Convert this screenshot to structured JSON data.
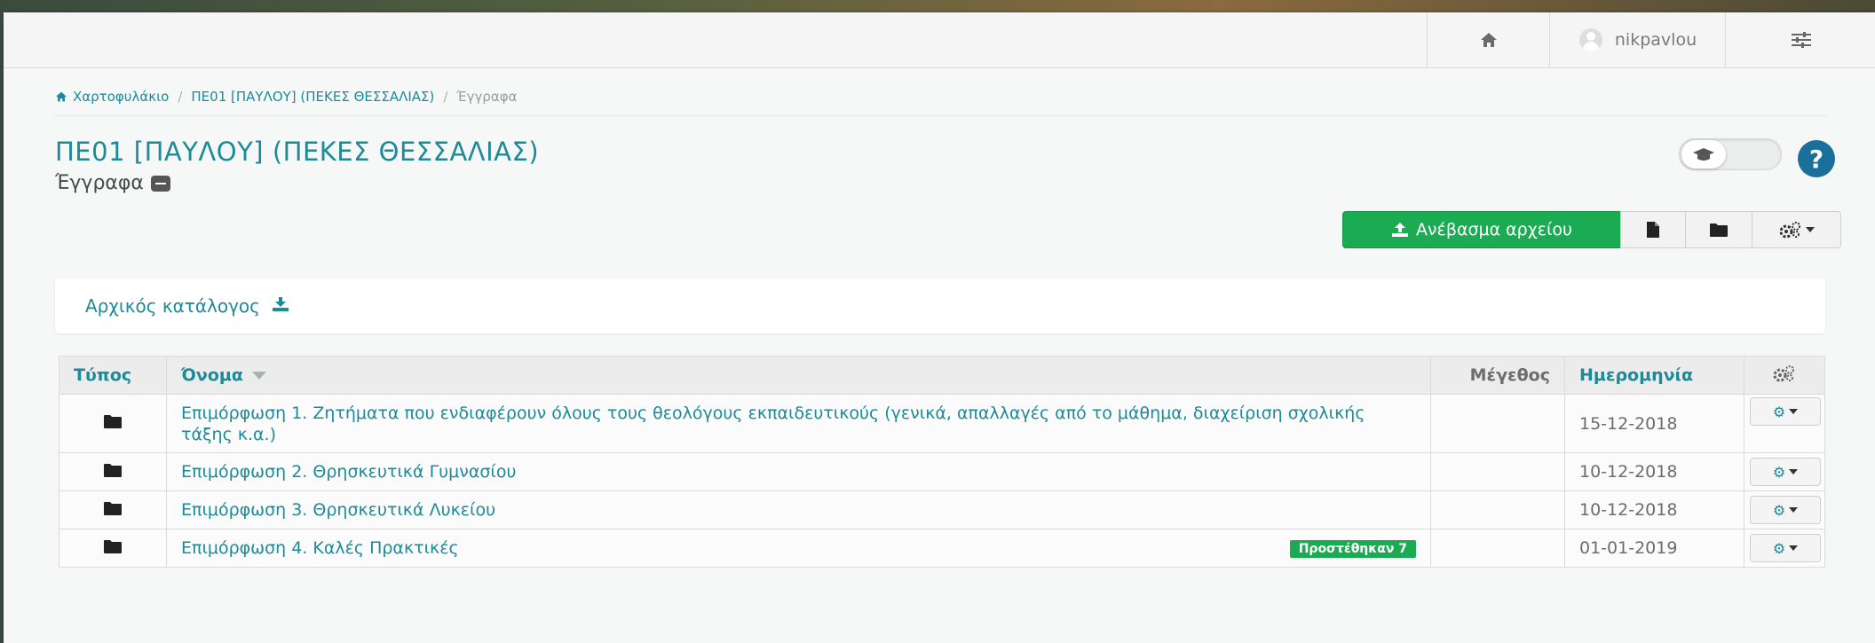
{
  "topbar": {
    "username": "nikpavlou"
  },
  "breadcrumb": {
    "items": [
      "Χαρτοφυλάκιο",
      "ΠΕ01 [ΠΑΥΛΟΥ] (ΠΕΚΕΣ ΘΕΣΣΑΛΙΑΣ)",
      "Έγγραφα"
    ],
    "separator": "/"
  },
  "page": {
    "title": "ΠΕ01 [ΠΑΥΛΟΥ] (ΠΕΚΕΣ ΘΕΣΣΑΛΙΑΣ)",
    "subtitle": "Έγγραφα"
  },
  "toolbar": {
    "upload_label": "Ανέβασμα αρχείου"
  },
  "panel": {
    "root_label": "Αρχικός κατάλογος"
  },
  "table": {
    "headers": {
      "type": "Τύπος",
      "name": "Όνομα",
      "size": "Μέγεθος",
      "date": "Ημερομηνία"
    },
    "rows": [
      {
        "name": "Επιμόρφωση 1. Ζητήματα που ενδιαφέρουν όλους τους θεολόγους εκπαιδευτικούς (γενικά, απαλλαγές από το μάθημα, διαχείριση σχολικής τάξης κ.α.)",
        "size": "",
        "date": "15-12-2018",
        "badge": ""
      },
      {
        "name": "Επιμόρφωση 2. Θρησκευτικά Γυμνασίου",
        "size": "",
        "date": "10-12-2018",
        "badge": ""
      },
      {
        "name": "Επιμόρφωση 3. Θρησκευτικά Λυκείου",
        "size": "",
        "date": "10-12-2018",
        "badge": ""
      },
      {
        "name": "Επιμόρφωση 4. Καλές Πρακτικές",
        "size": "",
        "date": "01-01-2019",
        "badge": "Προστέθηκαν 7"
      }
    ]
  },
  "icons": {
    "home": "home-icon",
    "user": "user-icon",
    "menu": "sliders-icon",
    "folder": "folder-icon",
    "file": "file-icon",
    "upload": "upload-icon",
    "download": "download-icon",
    "cogs": "cogs-icon",
    "cog": "cog-icon",
    "graduation": "graduation-cap-icon",
    "help": "question-icon"
  },
  "colors": {
    "accent": "#1d8a98",
    "success": "#1bab52",
    "help": "#1b6f9b"
  }
}
